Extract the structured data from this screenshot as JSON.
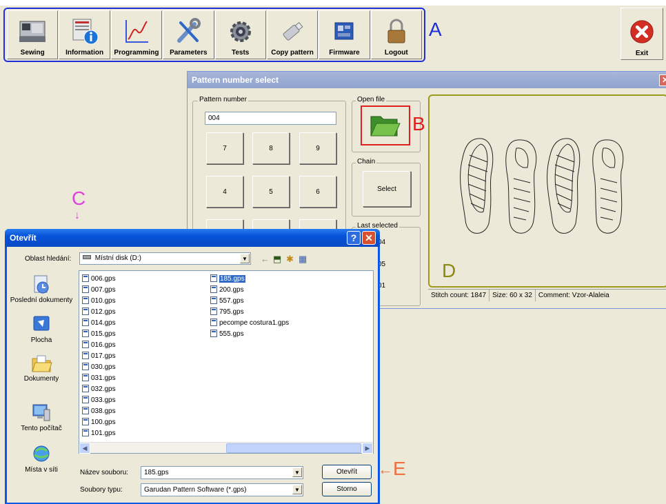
{
  "toolbar": {
    "items": [
      {
        "label": "Sewing"
      },
      {
        "label": "Information"
      },
      {
        "label": "Programming"
      },
      {
        "label": "Parameters"
      },
      {
        "label": "Tests"
      },
      {
        "label": "Copy pattern"
      },
      {
        "label": "Firmware"
      },
      {
        "label": "Logout"
      }
    ],
    "exit_label": "Exit"
  },
  "markers": {
    "a": "A",
    "b": "B",
    "c": "C",
    "d": "D",
    "e": "E"
  },
  "pattern_window": {
    "title": "Pattern number select",
    "pattern_number_label": "Pattern number",
    "pattern_number_value": "004",
    "keypad": [
      "7",
      "8",
      "9",
      "4",
      "5",
      "6"
    ],
    "open_file_label": "Open file",
    "chain_label": "Chain",
    "select_label": "Select",
    "last_selected_label": "Last selected",
    "last_selected_items": [
      "04",
      "05",
      "01"
    ],
    "status": {
      "stitch_count": "Stitch count: 1847",
      "size": "Size: 60 x 32",
      "comment": "Comment: Vzor-Alaleia"
    }
  },
  "open_dialog": {
    "title": "Otevřít",
    "look_in_label": "Oblast hledání:",
    "look_in_value": "Místní disk (D:)",
    "places": [
      "Poslední dokumenty",
      "Plocha",
      "Dokumenty",
      "Tento počítač",
      "Místa v síti"
    ],
    "files_col1": [
      "006.gps",
      "007.gps",
      "010.gps",
      "012.gps",
      "014.gps",
      "015.gps",
      "016.gps",
      "017.gps",
      "030.gps",
      "031.gps",
      "032.gps",
      "033.gps",
      "038.gps",
      "100.gps",
      "101.gps"
    ],
    "files_col2": [
      "185.gps",
      "200.gps",
      "557.gps",
      "795.gps",
      "pecompe costura1.gps",
      "555.gps"
    ],
    "selected_file": "185.gps",
    "file_name_label": "Název souboru:",
    "file_name_value": "185.gps",
    "file_type_label": "Soubory typu:",
    "file_type_value": "Garudan Pattern Software (*.gps)",
    "open_button": "Otevřít",
    "cancel_button": "Storno",
    "help_glyph": "?",
    "close_glyph": "✕"
  },
  "colors": {
    "marker_a": "#1f2fd8",
    "marker_b": "#e0201e",
    "marker_c": "#e040e0",
    "marker_d": "#8c8a10",
    "marker_e": "#f07040",
    "xp_title": "#0a4bc4"
  }
}
